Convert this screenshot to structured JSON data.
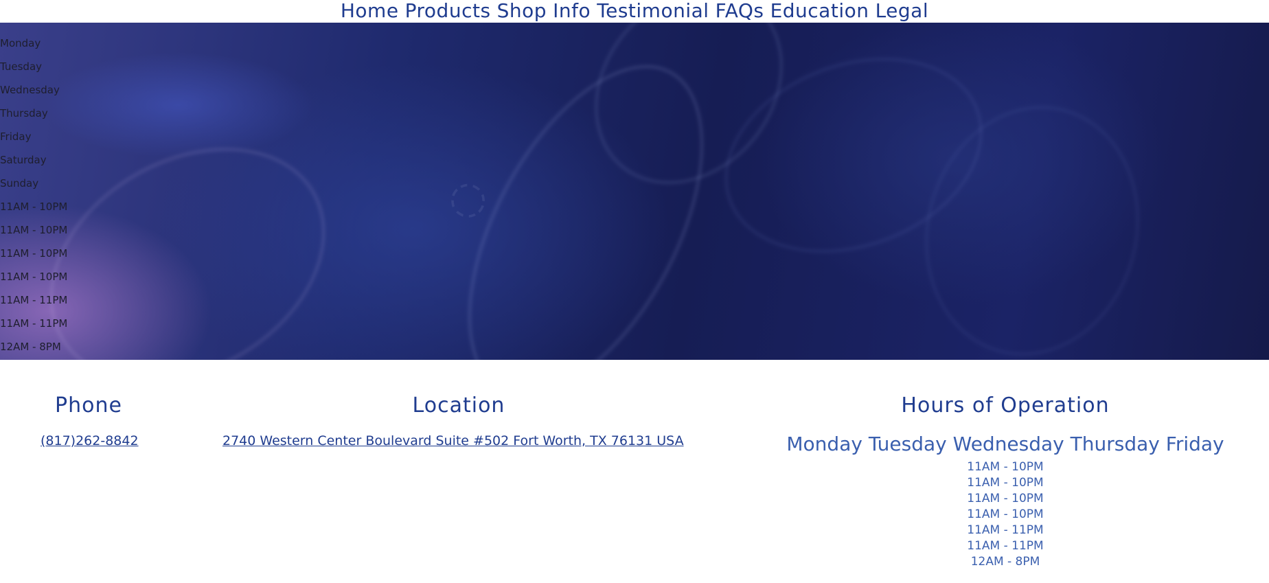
{
  "nav": {
    "items": [
      "Home",
      "Products",
      "Shop",
      "Info",
      "Testimonial",
      "FAQs",
      "Education",
      "Legal"
    ]
  },
  "hero": {
    "hours_list": [
      "Monday",
      "Tuesday",
      "Wednesday",
      "Thursday",
      "Friday",
      "Saturday",
      "Sunday",
      "11AM - 10PM",
      "11AM - 10PM",
      "11AM - 10PM",
      "11AM - 10PM",
      "11AM - 11PM",
      "11AM - 11PM",
      "12AM - 8PM"
    ]
  },
  "phone": {
    "title": "Phone",
    "number": "(817)262-8842"
  },
  "location": {
    "title": "Location",
    "address": "2740 Western Center Boulevard Suite #502 Fort Worth, TX 76131 USA"
  },
  "hours": {
    "title": "Hours of Operation",
    "days": "Monday Tuesday Wednesday Thursday Friday",
    "times": [
      "11AM - 10PM",
      "11AM - 10PM",
      "11AM - 10PM",
      "11AM - 10PM",
      "11AM - 11PM",
      "11AM - 11PM",
      "12AM - 8PM"
    ]
  },
  "colors": {
    "accent": "#1f3c8f",
    "hours_text": "#3a5fae",
    "hero_dark": "#161d54"
  }
}
